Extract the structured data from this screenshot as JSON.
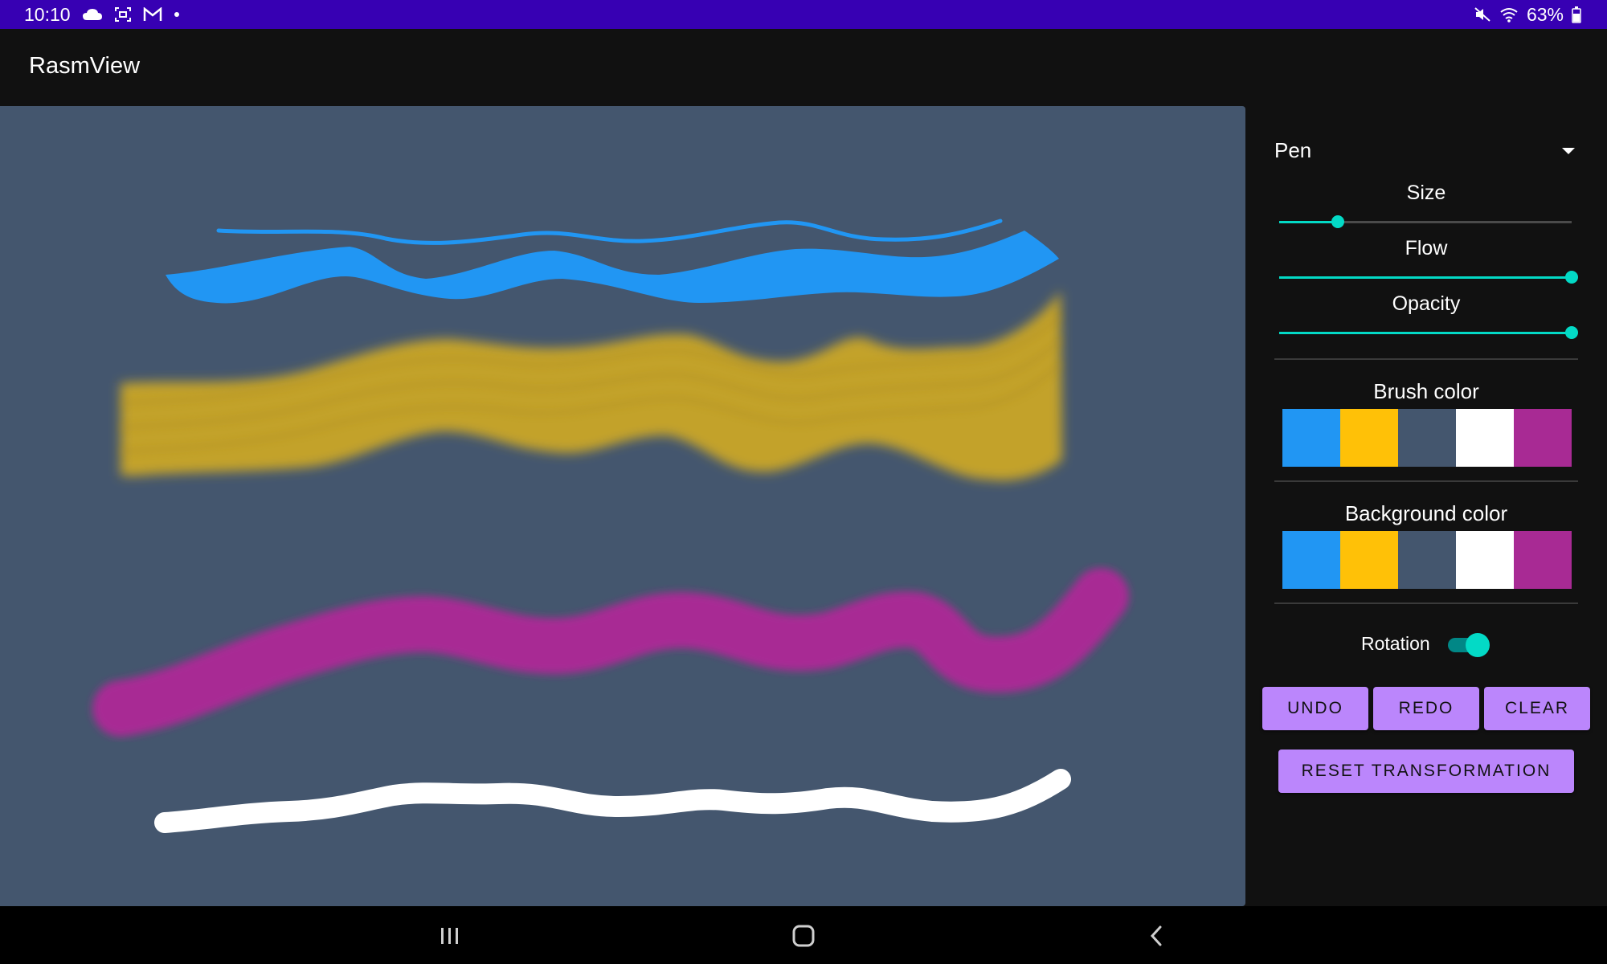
{
  "status_bar": {
    "time": "10:10",
    "left_icons": [
      "cloud-icon",
      "screenshot-icon",
      "gmail-icon",
      "dot-icon"
    ],
    "right_icons": [
      "mute-icon",
      "wifi-icon",
      "battery-icon"
    ],
    "battery": "63%"
  },
  "app": {
    "title": "RasmView"
  },
  "canvas": {
    "background_color": "#44566e",
    "strokes": [
      {
        "color": "#2196f3",
        "style": "thin-line"
      },
      {
        "color": "#2196f3",
        "style": "calligraphy-ribbon"
      },
      {
        "color": "#c3a22b",
        "style": "blurred-bristle"
      },
      {
        "color": "#a82a94",
        "style": "blurred-thick"
      },
      {
        "color": "#ffffff",
        "style": "round-thick"
      }
    ]
  },
  "panel": {
    "tool": {
      "selected": "Pen"
    },
    "sliders": [
      {
        "label": "Size",
        "value_fraction": 0.2
      },
      {
        "label": "Flow",
        "value_fraction": 1.0
      },
      {
        "label": "Opacity",
        "value_fraction": 1.0
      }
    ],
    "brush_color": {
      "title": "Brush color",
      "colors": [
        "#2196f3",
        "#ffc107",
        "#44566e",
        "#ffffff",
        "#a82a94"
      ]
    },
    "background_color": {
      "title": "Background color",
      "colors": [
        "#2196f3",
        "#ffc107",
        "#44566e",
        "#ffffff",
        "#a82a94"
      ]
    },
    "rotation": {
      "label": "Rotation",
      "enabled": true
    },
    "buttons": {
      "undo": "UNDO",
      "redo": "REDO",
      "clear": "CLEAR",
      "reset": "RESET TRANSFORMATION"
    }
  },
  "nav_bar": {
    "icons": [
      "recents-icon",
      "home-icon",
      "back-icon"
    ]
  },
  "colors": {
    "accent": "#03dac6",
    "button": "#bb86fc",
    "status_bar": "#3700b3"
  }
}
